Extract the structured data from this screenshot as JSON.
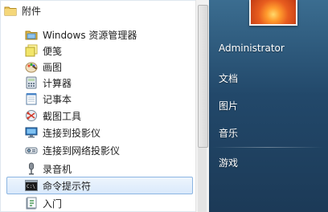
{
  "programs": {
    "folder_label": "附件",
    "items": [
      {
        "label": "Windows 资源管理器",
        "icon": "explorer-folder-icon"
      },
      {
        "label": "便笺",
        "icon": "sticky-notes-icon"
      },
      {
        "label": "画图",
        "icon": "paint-icon"
      },
      {
        "label": "计算器",
        "icon": "calculator-icon"
      },
      {
        "label": "记事本",
        "icon": "notepad-icon"
      },
      {
        "label": "截图工具",
        "icon": "snipping-tool-icon"
      },
      {
        "label": "连接到投影仪",
        "icon": "projector-icon"
      },
      {
        "label": "连接到网络投影仪",
        "icon": "network-projector-icon"
      },
      {
        "label": "录音机",
        "icon": "microphone-icon"
      },
      {
        "label": "命令提示符",
        "icon": "command-prompt-icon"
      },
      {
        "label": "入门",
        "icon": "getting-started-icon"
      }
    ],
    "selected_index": 9
  },
  "user": {
    "name": "Administrator"
  },
  "right_links": [
    "文档",
    "图片",
    "音乐",
    "游戏"
  ]
}
